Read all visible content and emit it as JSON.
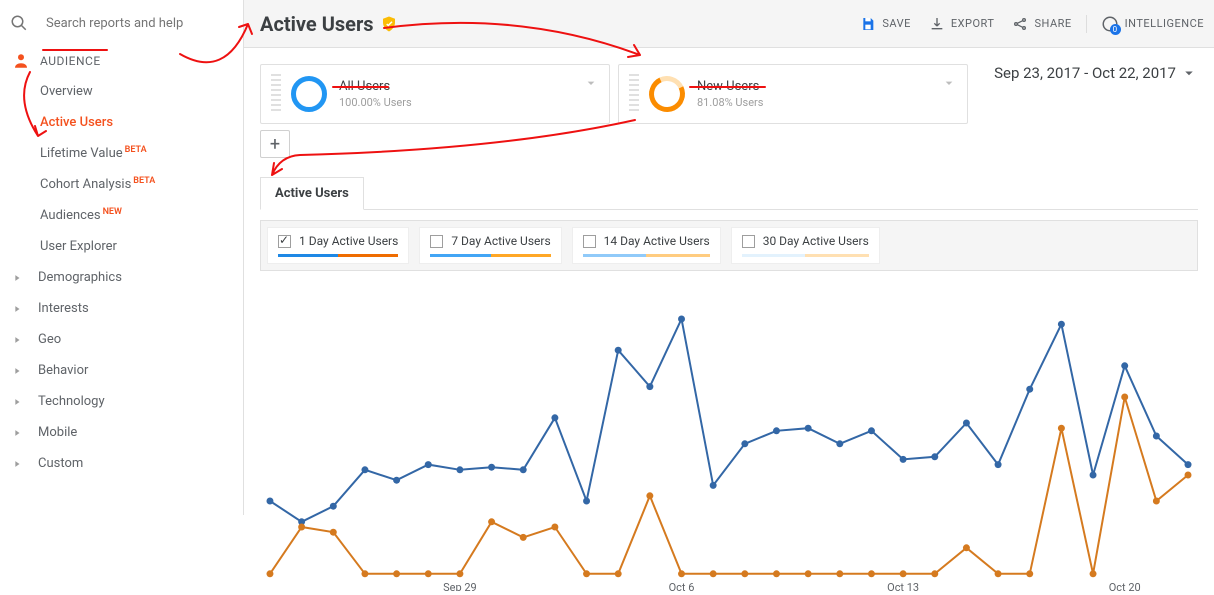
{
  "search": {
    "placeholder": "Search reports and help"
  },
  "sidebar": {
    "section_label": "AUDIENCE",
    "items": [
      {
        "label": "Overview"
      },
      {
        "label": "Active Users"
      },
      {
        "label": "Lifetime Value",
        "badge": "BETA"
      },
      {
        "label": "Cohort Analysis",
        "badge": "BETA"
      },
      {
        "label": "Audiences",
        "badge": "NEW"
      },
      {
        "label": "User Explorer"
      },
      {
        "label": "Demographics",
        "caret": true
      },
      {
        "label": "Interests",
        "caret": true
      },
      {
        "label": "Geo",
        "caret": true
      },
      {
        "label": "Behavior",
        "caret": true
      },
      {
        "label": "Technology",
        "caret": true
      },
      {
        "label": "Mobile",
        "caret": true
      },
      {
        "label": "Custom",
        "caret": true
      }
    ]
  },
  "header": {
    "title": "Active Users",
    "actions": {
      "save": "SAVE",
      "export": "EXPORT",
      "share": "SHARE",
      "intelligence": "INTELLIGENCE"
    }
  },
  "date_range": "Sep 23, 2017 - Oct 22, 2017",
  "segments": [
    {
      "name": "All Users",
      "subtitle": "100.00% Users",
      "color": "blue"
    },
    {
      "name": "New Users",
      "subtitle": "81.08% Users",
      "color": "orange"
    }
  ],
  "tab_label": "Active Users",
  "metrics": [
    {
      "label": "1 Day Active Users",
      "checked": true,
      "colors": [
        "#1e88e5",
        "#ef6c00"
      ]
    },
    {
      "label": "7 Day Active Users",
      "checked": false,
      "colors": [
        "#42a5f5",
        "#ffa726"
      ]
    },
    {
      "label": "14 Day Active Users",
      "checked": false,
      "colors": [
        "#90caf9",
        "#ffcc80"
      ]
    },
    {
      "label": "30 Day Active Users",
      "checked": false,
      "colors": [
        "#e3f2fd",
        "#ffe0b2"
      ]
    }
  ],
  "chart_data": {
    "type": "line",
    "x_ticks": [
      "Sep 29",
      "Oct 6",
      "Oct 13",
      "Oct 20"
    ],
    "x_tick_positions": [
      6,
      13,
      20,
      27
    ],
    "x": [
      0,
      1,
      2,
      3,
      4,
      5,
      6,
      7,
      8,
      9,
      10,
      11,
      12,
      13,
      14,
      15,
      16,
      17,
      18,
      19,
      20,
      21,
      22,
      23,
      24,
      25,
      26,
      27,
      28,
      29
    ],
    "series": [
      {
        "name": "All Users – 1 Day Active",
        "color": "#3367a6",
        "values": [
          30,
          22,
          28,
          42,
          38,
          44,
          42,
          43,
          42,
          62,
          30,
          88,
          74,
          100,
          36,
          52,
          57,
          58,
          52,
          57,
          46,
          47,
          60,
          44,
          73,
          98,
          40,
          82,
          55,
          44
        ]
      },
      {
        "name": "New Users – 1 Day Active",
        "color": "#d57a1f",
        "values": [
          2,
          20,
          18,
          2,
          2,
          2,
          2,
          22,
          16,
          20,
          2,
          2,
          32,
          2,
          2,
          2,
          2,
          2,
          2,
          2,
          2,
          2,
          12,
          2,
          2,
          58,
          2,
          70,
          30,
          40
        ]
      }
    ],
    "ylim": [
      0,
      100
    ]
  }
}
